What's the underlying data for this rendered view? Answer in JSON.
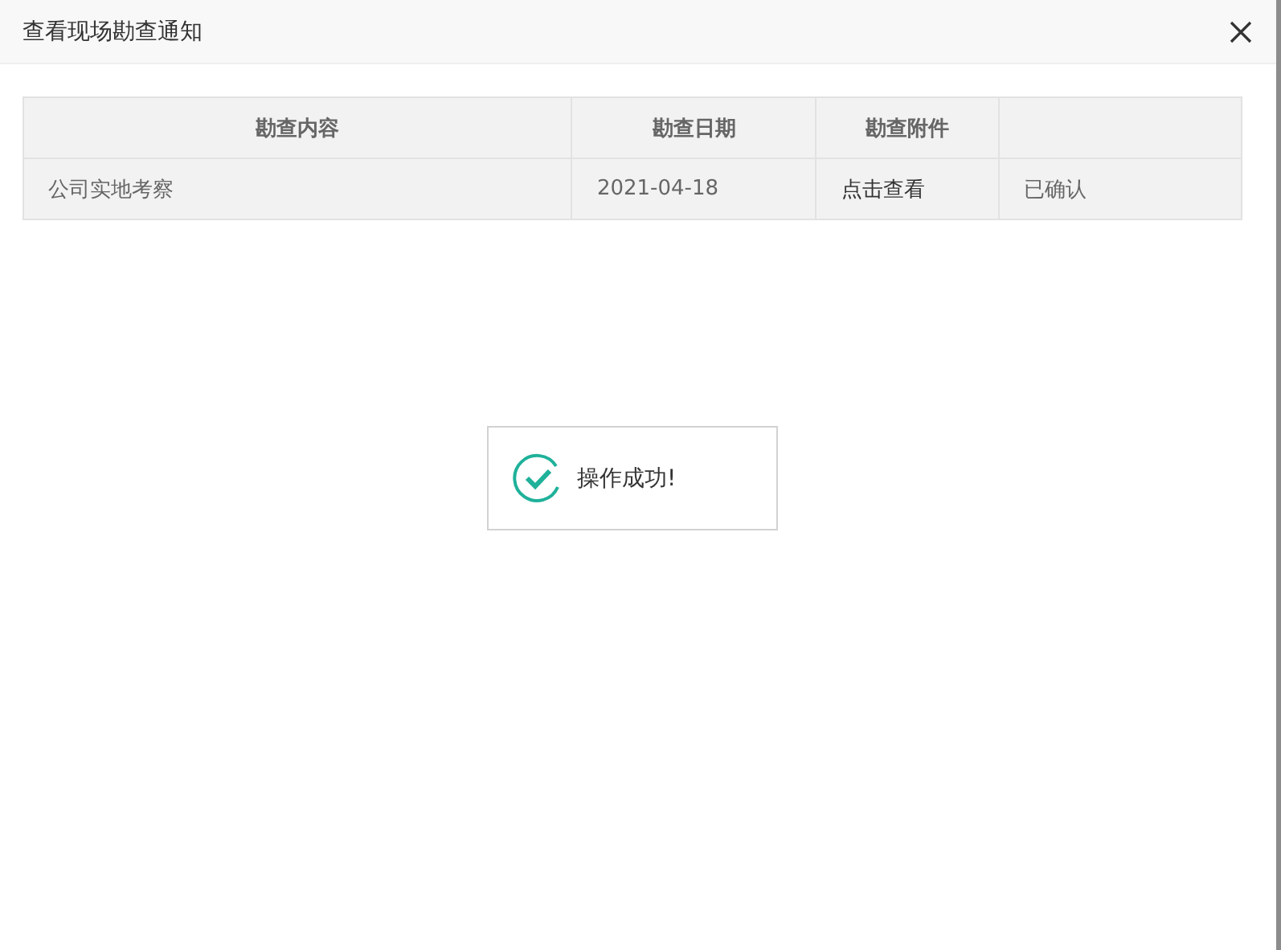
{
  "dialog": {
    "title": "查看现场勘查通知"
  },
  "table": {
    "columns": [
      "勘查内容",
      "勘查日期",
      "勘查附件",
      ""
    ],
    "rows": [
      {
        "cells": [
          {
            "kind": "text",
            "text": "公司实地考察"
          },
          {
            "kind": "text",
            "text": "2021-04-18"
          },
          {
            "kind": "link",
            "text": "点击查看"
          },
          {
            "kind": "text",
            "text": "已确认"
          }
        ]
      }
    ]
  },
  "toast": {
    "message": "操作成功!"
  }
}
